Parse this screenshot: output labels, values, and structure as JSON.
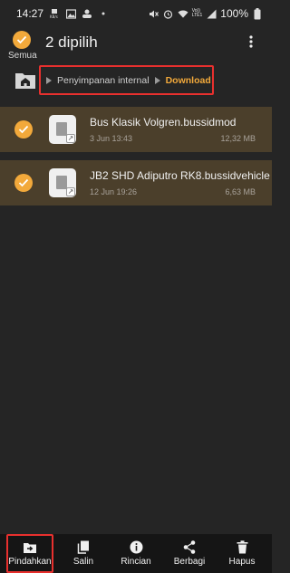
{
  "status_bar": {
    "time": "14:27",
    "left_icons": [
      "kbs-icon",
      "image-icon",
      "game-controller-icon",
      "dot-icon"
    ],
    "right_icons": [
      "mute-icon",
      "alarm-icon",
      "wifi-icon",
      "volte-icon",
      "signal-icon"
    ],
    "network_label_top": "Vo))",
    "network_label_bottom": "LTE1",
    "battery": "100%"
  },
  "header": {
    "select_all_label": "Semua",
    "title": "2 dipilih",
    "more_icon": "more-vertical-icon"
  },
  "path": {
    "home_icon": "home-folder-icon",
    "items": [
      "Penyimpanan internal"
    ],
    "current": "Download"
  },
  "files": [
    {
      "name": "Bus Klasik Volgren.bussidmod",
      "date": "3 Jun 13:43",
      "size": "12,32 MB",
      "selected": true
    },
    {
      "name": "JB2 SHD Adiputro RK8.bussidvehicle",
      "date": "12 Jun 19:26",
      "size": "6,63 MB",
      "selected": true
    }
  ],
  "bottom_actions": [
    {
      "label": "Pindahkan",
      "icon": "move-folder-icon"
    },
    {
      "label": "Salin",
      "icon": "copy-icon"
    },
    {
      "label": "Rincian",
      "icon": "info-icon"
    },
    {
      "label": "Berbagi",
      "icon": "share-icon"
    },
    {
      "label": "Hapus",
      "icon": "trash-icon"
    }
  ],
  "colors": {
    "background": "#252525",
    "accent": "#f2a93b",
    "selected_row": "#4b3f2b",
    "highlight_box": "#e8302e",
    "bottom_bar": "#151515"
  }
}
